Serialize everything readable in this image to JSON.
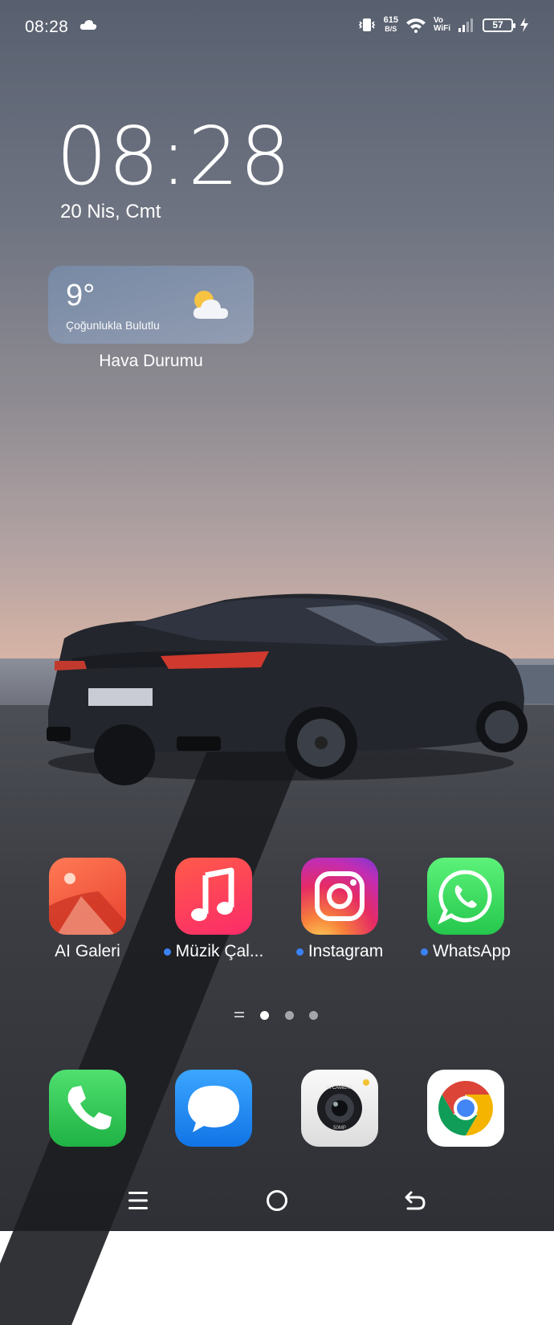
{
  "status_bar": {
    "time": "08:28",
    "cloud_icon": "cloud-icon",
    "net_speed_value": "615",
    "net_speed_unit": "B/S",
    "vowifi_top": "Vo",
    "vowifi_bottom": "WiFi",
    "battery_level": "57"
  },
  "lock_clock": {
    "time": "08:28",
    "date": "20 Nis, Cmt"
  },
  "weather_widget": {
    "temperature": "9°",
    "condition": "Çoğunlukla Bulutlu",
    "label": "Hava Durumu",
    "icon": "partly-cloudy-icon"
  },
  "home_apps": [
    {
      "label": "AI Galeri",
      "new_dot": false,
      "icon": "gallery-icon"
    },
    {
      "label": "Müzik Çal...",
      "new_dot": true,
      "icon": "music-icon"
    },
    {
      "label": "Instagram",
      "new_dot": true,
      "icon": "instagram-icon"
    },
    {
      "label": "WhatsApp",
      "new_dot": true,
      "icon": "whatsapp-icon"
    }
  ],
  "pager": {
    "pages": 3,
    "active": 0
  },
  "dock": [
    {
      "icon": "phone-icon"
    },
    {
      "icon": "messages-icon"
    },
    {
      "icon": "camera-icon",
      "badge_text_top": "AI CAMERA",
      "badge_text_bottom": "50MP"
    },
    {
      "icon": "chrome-icon"
    }
  ],
  "colors": {
    "accent_dot": "#3b82f6",
    "gallery": "#f0553e",
    "music": "#fb3b5b",
    "whatsapp": "#25d366",
    "phone": "#2bc04f",
    "messages": "#1e88f5"
  }
}
